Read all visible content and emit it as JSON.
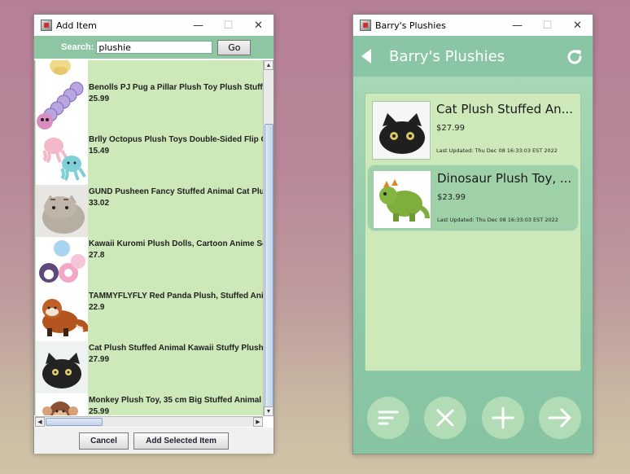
{
  "left_window": {
    "title": "Add Item",
    "controls": {
      "minimize": "—",
      "maximize": "☐",
      "close": "✕"
    },
    "search": {
      "label": "Search:",
      "value": "plushie",
      "go_label": "Go"
    },
    "items": [
      {
        "name": "Benolls PJ Pug a Pillar Plush Toy Plush Stuffed",
        "price": "25.99",
        "thumb": "caterpillar-plush-image"
      },
      {
        "name": "Brlly Octopus Plush Toys Double-Sided Flip Octopus",
        "price": "15.49",
        "thumb": "octopus-plush-image"
      },
      {
        "name": "GUND Pusheen Fancy Stuffed Animal Cat Plush",
        "price": "33.02",
        "thumb": "pusheen-plush-image"
      },
      {
        "name": "Kawaii Kuromi Plush Dolls, Cartoon Anime Soft",
        "price": "27.8",
        "thumb": "kuromi-plush-image"
      },
      {
        "name": "TAMMYFLYFLY Red Panda Plush, Stuffed Animal",
        "price": "22.9",
        "thumb": "red-panda-plush-image"
      },
      {
        "name": "Cat Plush Stuffed Animal Kawaii Stuffy Plush",
        "price": "27.99",
        "thumb": "black-cat-plush-image"
      },
      {
        "name": "Monkey Plush Toy, 35 cm Big Stuffed Animal",
        "price": "25.99",
        "thumb": "monkey-plush-image"
      }
    ],
    "buttons": {
      "cancel": "Cancel",
      "add": "Add Selected Item"
    }
  },
  "right_window": {
    "title": "Barry's Plushies",
    "controls": {
      "minimize": "—",
      "maximize": "☐",
      "close": "✕"
    },
    "header_title": "Barry's Plushies",
    "cards": [
      {
        "title": "Cat Plush Stuffed An...",
        "price": "$27.99",
        "updated": "Last Updated: Thu Dec 08 16:33:03 EST 2022",
        "selected": false
      },
      {
        "title": "Dinosaur Plush Toy, ...",
        "price": "$23.99",
        "updated": "Last Updated: Thu Dec 08 16:33:03 EST 2022",
        "selected": true
      }
    ],
    "actions": [
      "sort-icon",
      "delete-icon",
      "add-icon",
      "next-icon"
    ]
  },
  "colors": {
    "accent_green": "#8ac6a5",
    "list_bg": "#cde8b9",
    "selected_card": "#9fd1a8",
    "fab": "#b1dcb6"
  }
}
